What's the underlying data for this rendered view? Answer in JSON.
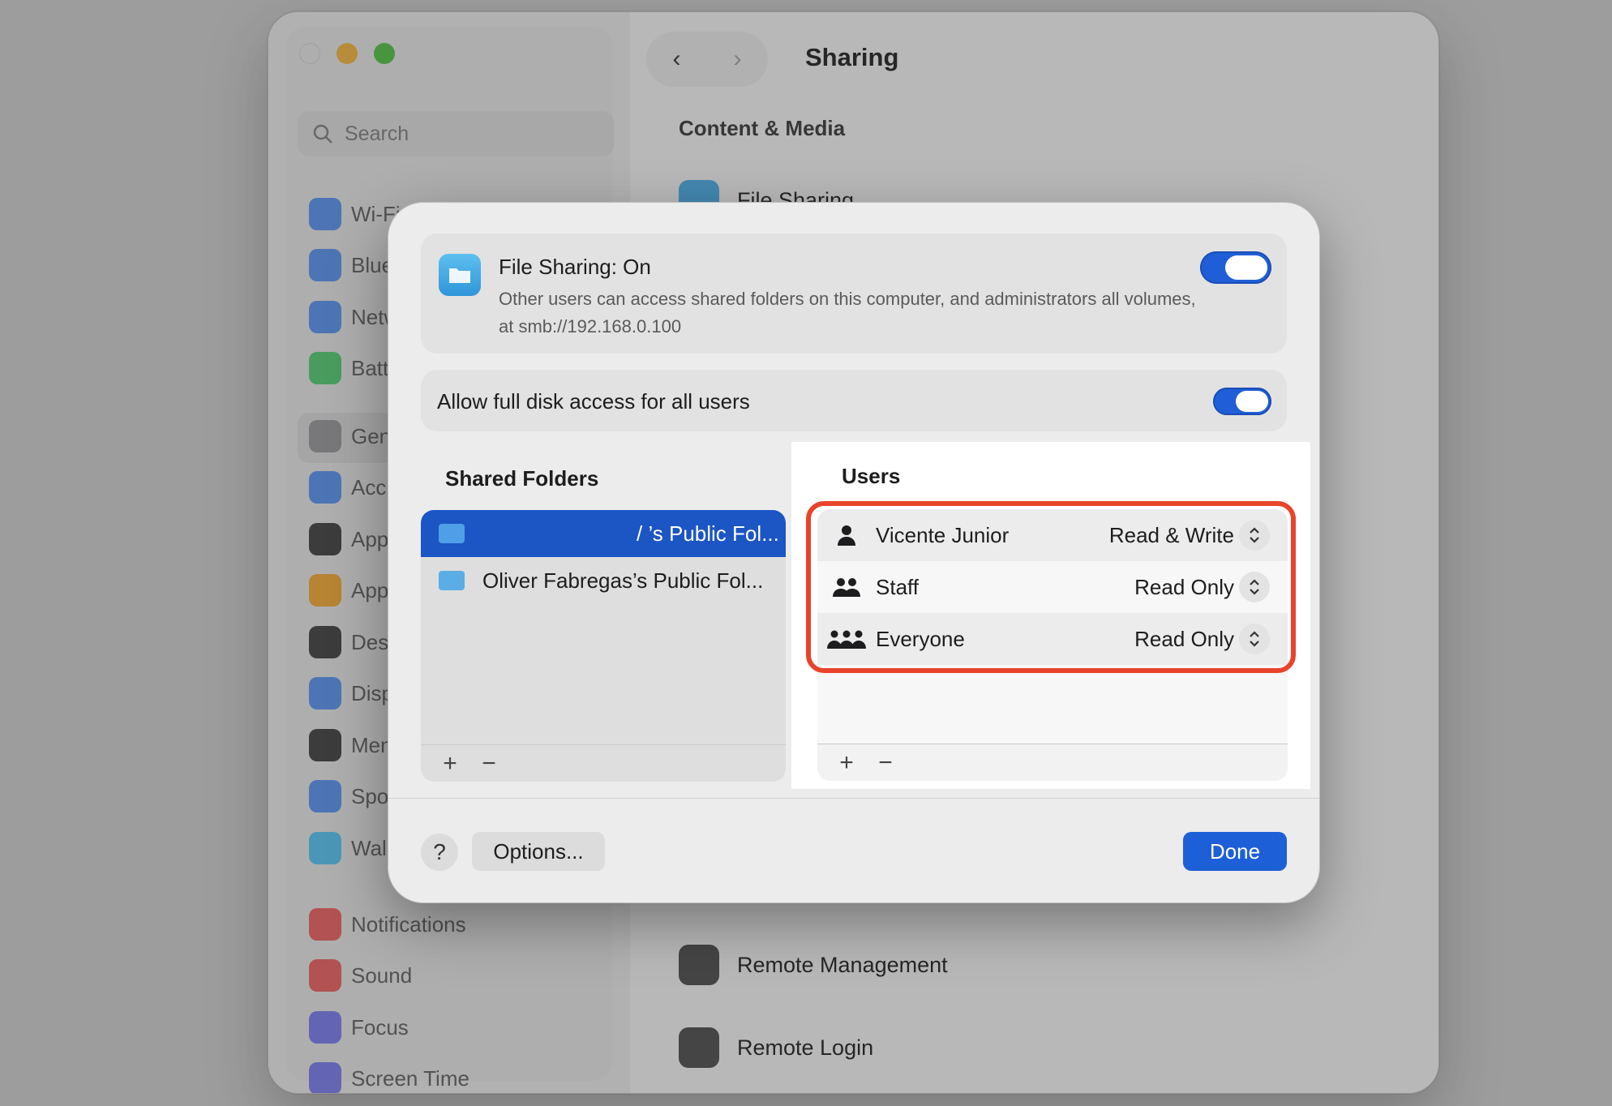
{
  "window": {
    "title": "Sharing",
    "search_placeholder": "Search",
    "section_title": "Content & Media"
  },
  "sidebar": {
    "items": [
      {
        "label": "Wi-Fi",
        "icon": "wifi-icon",
        "color": "#3b82f6"
      },
      {
        "label": "Blue",
        "icon": "bluetooth-icon",
        "color": "#3b82f6"
      },
      {
        "label": "Netw",
        "icon": "network-icon",
        "color": "#3b82f6"
      },
      {
        "label": "Batt",
        "icon": "battery-icon",
        "color": "#34c759"
      },
      {
        "label": "Gen",
        "icon": "gear-icon",
        "color": "#8e8e93"
      },
      {
        "label": "Acc",
        "icon": "accessibility-icon",
        "color": "#3b82f6"
      },
      {
        "label": "App",
        "icon": "appearance-icon",
        "color": "#1d1d1f"
      },
      {
        "label": "App",
        "icon": "apple-intelligence-icon",
        "color": "#f59e0b"
      },
      {
        "label": "Des",
        "icon": "desktop-icon",
        "color": "#1d1d1f"
      },
      {
        "label": "Disp",
        "icon": "display-icon",
        "color": "#3b82f6"
      },
      {
        "label": "Men",
        "icon": "menu-bar-icon",
        "color": "#1d1d1f"
      },
      {
        "label": "Spo",
        "icon": "spotlight-icon",
        "color": "#3b82f6"
      },
      {
        "label": "Wall",
        "icon": "wallpaper-icon",
        "color": "#38bdf8"
      },
      {
        "label": "Notifications",
        "icon": "bell-icon",
        "color": "#ef4444"
      },
      {
        "label": "Sound",
        "icon": "speaker-icon",
        "color": "#ef4444"
      },
      {
        "label": "Focus",
        "icon": "moon-icon",
        "color": "#6366f1"
      },
      {
        "label": "Screen Time",
        "icon": "hourglass-icon",
        "color": "#6366f1"
      }
    ]
  },
  "services": {
    "file_sharing": "File Sharing",
    "remote_management": "Remote Management",
    "remote_login": "Remote Login"
  },
  "sheet": {
    "file_sharing_title": "File Sharing: On",
    "file_sharing_desc": "Other users can access shared folders on this computer, and administrators all volumes, at smb://192.168.0.100",
    "full_disk_label": "Allow full disk access for all users",
    "shared_folders_title": "Shared Folders",
    "users_title": "Users",
    "folders": [
      {
        "label": "/ ’s Public Fol...",
        "selected": true
      },
      {
        "label": "Oliver Fabregas’s Public Fol...",
        "selected": false
      }
    ],
    "users": [
      {
        "name": "Vicente Junior",
        "permission": "Read & Write",
        "icon": "person-icon"
      },
      {
        "name": "Staff",
        "permission": "Read Only",
        "icon": "group-icon"
      },
      {
        "name": "Everyone",
        "permission": "Read Only",
        "icon": "everyone-icon"
      }
    ],
    "add_label": "+",
    "remove_label": "−",
    "help_label": "?",
    "options_label": "Options...",
    "done_label": "Done"
  },
  "colors": {
    "accent": "#1d5fd6",
    "highlight": "#e8442b"
  }
}
